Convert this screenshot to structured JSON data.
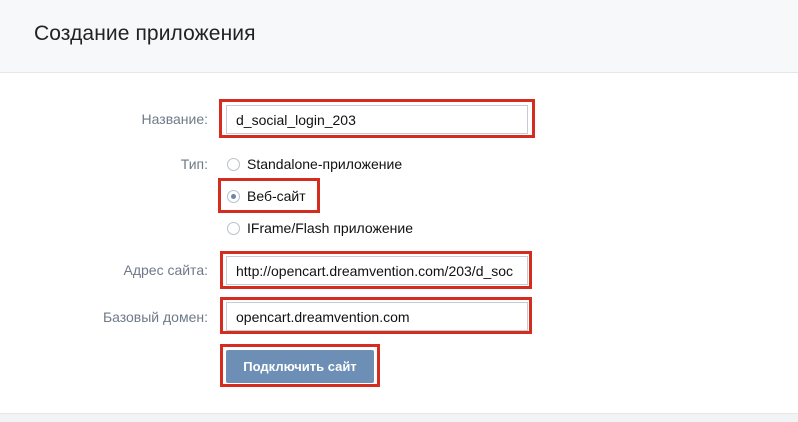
{
  "header": {
    "title": "Создание приложения"
  },
  "form": {
    "name": {
      "label": "Название:",
      "value": "d_social_login_203"
    },
    "type": {
      "label": "Тип:",
      "options": [
        {
          "label": "Standalone-приложение",
          "checked": false
        },
        {
          "label": "Веб-сайт",
          "checked": true
        },
        {
          "label": "IFrame/Flash приложение",
          "checked": false
        }
      ]
    },
    "site_address": {
      "label": "Адрес сайта:",
      "value": "http://opencart.dreamvention.com/203/d_soc"
    },
    "base_domain": {
      "label": "Базовый домен:",
      "value": "opencart.dreamvention.com"
    },
    "submit_label": "Подключить сайт"
  },
  "colors": {
    "highlight": "#d42d1f",
    "button": "#6d8fb6",
    "header_bg": "#f7f8fa",
    "label": "#6f7a87"
  }
}
